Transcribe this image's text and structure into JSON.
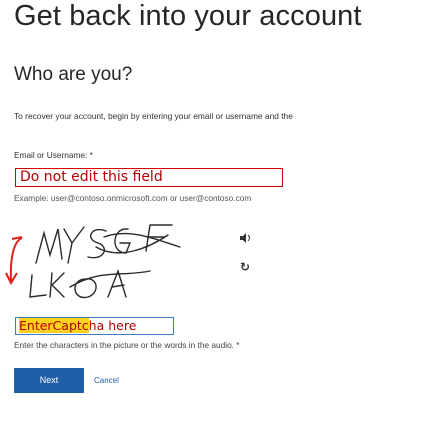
{
  "page": {
    "title": "Get back into your account",
    "subtitle": "Who are you?",
    "description": "To recover your account, begin by entering your email or username and the"
  },
  "form": {
    "email_label": "Email or Username: *",
    "email_value": "Do not edit this field",
    "example": "Example: user@contoso.onmicrosoft.com or user@contoso.com",
    "captcha_text": "MYSGF LKOA",
    "captcha_value_highlight": "EnterCaptc",
    "captcha_value_rest": "ha here",
    "captcha_hint": "Enter the characters in the picture or the words in the audio. *",
    "audio_icon": "speaker-icon",
    "refresh_icon": "refresh-icon"
  },
  "buttons": {
    "next": "Next",
    "cancel": "Cancel"
  },
  "colors": {
    "accent": "#1f5fa8",
    "error_outline": "#d40000",
    "highlight": "#ffd11a",
    "annotation_arrow": "#e0201a"
  }
}
